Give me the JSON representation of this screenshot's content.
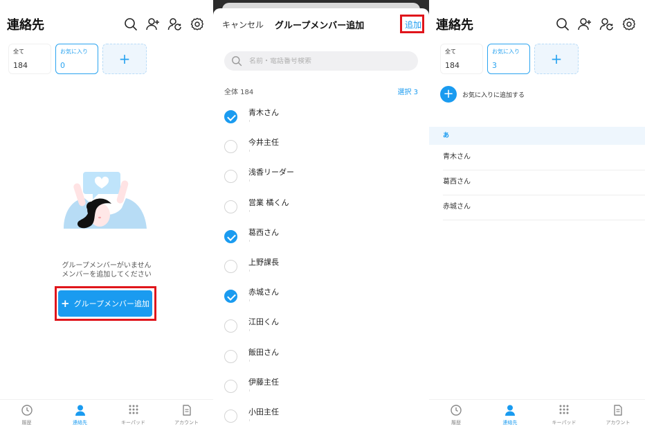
{
  "colors": {
    "accent": "#1a9bf0",
    "highlight": "#e0151b"
  },
  "screens": [
    {
      "header": {
        "title": "連絡先",
        "icons": [
          "search-icon",
          "add-user-icon",
          "user-sync-icon",
          "settings-icon"
        ]
      },
      "chips": {
        "all_label": "全て",
        "all_count": "184",
        "fav_label": "お気に入り",
        "fav_count": "0",
        "add": "+"
      },
      "empty": {
        "line1": "グループメンバーがいません",
        "line2": "メンバーを追加してください",
        "button": "グループメンバー追加",
        "button_icon": "+"
      },
      "tabs": [
        {
          "label": "履歴",
          "icon": "clock-icon"
        },
        {
          "label": "連絡先",
          "icon": "person-icon",
          "active": true
        },
        {
          "label": "キーパッド",
          "icon": "keypad-icon"
        },
        {
          "label": "アカウント",
          "icon": "document-icon"
        }
      ]
    },
    {
      "sheet": {
        "cancel": "キャンセル",
        "title": "グループメンバー追加",
        "add": "追加",
        "search_placeholder": "名前・電話番号検索",
        "total_label": "全体 184",
        "selected_label": "選択 3",
        "members": [
          {
            "name": "青木さん",
            "checked": true
          },
          {
            "name": "今井主任",
            "checked": false
          },
          {
            "name": "浅香リーダー",
            "checked": false
          },
          {
            "name": "営業 橘くん",
            "checked": false
          },
          {
            "name": "葛西さん",
            "checked": true
          },
          {
            "name": "上野課長",
            "checked": false
          },
          {
            "name": "赤城さん",
            "checked": true
          },
          {
            "name": "江田くん",
            "checked": false
          },
          {
            "name": "飯田さん",
            "checked": false
          },
          {
            "name": "伊藤主任",
            "checked": false
          },
          {
            "name": "小田主任",
            "checked": false
          }
        ]
      }
    },
    {
      "header": {
        "title": "連絡先"
      },
      "chips": {
        "all_label": "全て",
        "all_count": "184",
        "fav_label": "お気に入り",
        "fav_count": "3",
        "add": "+"
      },
      "fav_add_label": "お気に入りに追加する",
      "fav_add_icon": "+",
      "section": "あ",
      "contacts": [
        "青木さん",
        "葛西さん",
        "赤城さん"
      ],
      "tabs": [
        {
          "label": "履歴",
          "icon": "clock-icon"
        },
        {
          "label": "連絡先",
          "icon": "person-icon",
          "active": true
        },
        {
          "label": "キーパッド",
          "icon": "keypad-icon"
        },
        {
          "label": "アカウント",
          "icon": "document-icon"
        }
      ]
    }
  ]
}
